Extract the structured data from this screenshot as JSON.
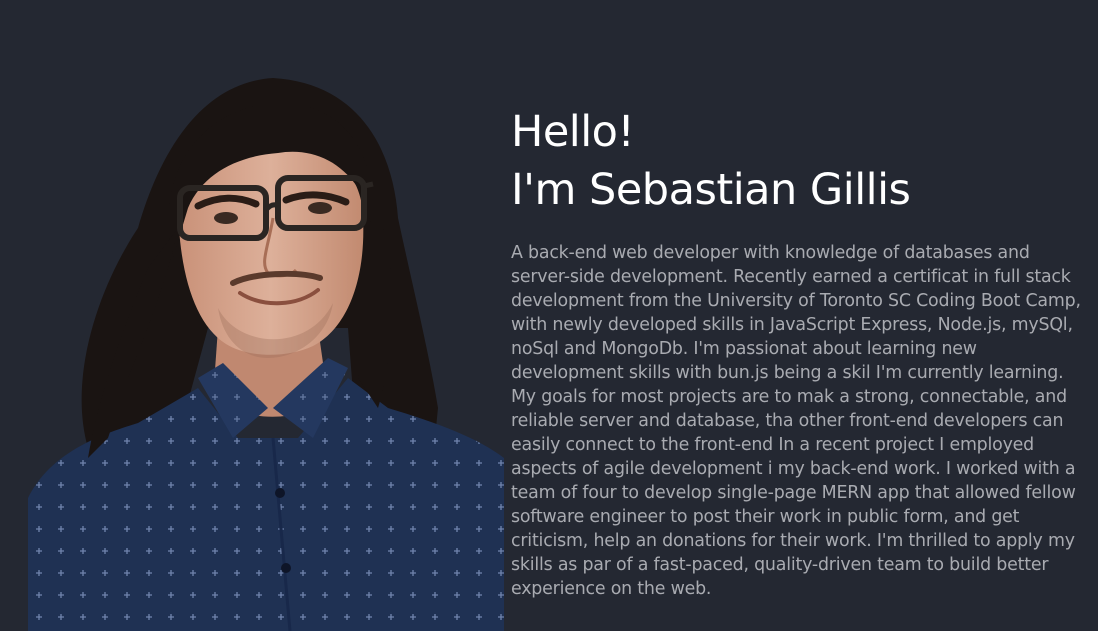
{
  "hero": {
    "greeting": "Hello!",
    "name_line": "I'm Sebastian Gillis",
    "bio": "A back-end web developer with knowledge of databases and server-side development. Recently earned a certificat in full stack development from the University of Toronto SC Coding Boot Camp, with newly developed skills in JavaScript Express, Node.js, mySQl, noSql and MongoDb. I'm passionat about learning new development skills with bun.js being a skil I'm currently learning. My goals for most projects are to mak a strong, connectable, and reliable server and database, tha other front-end developers can easily connect to the front-end In a recent project I employed aspects of agile development i my back-end work. I worked with a team of four to develop single-page MERN app that allowed fellow software engineer to post their work in public form, and get criticism, help an donations for their work. I'm thrilled to apply my skills as par of a fast-paced, quality-driven team to build better experience on the web."
  },
  "colors": {
    "background": "#242832",
    "heading": "#ffffff",
    "body_text": "#a9abb1",
    "shirt": "#1f3153",
    "hair": "#1a1412",
    "skin": "#d7a58c"
  }
}
